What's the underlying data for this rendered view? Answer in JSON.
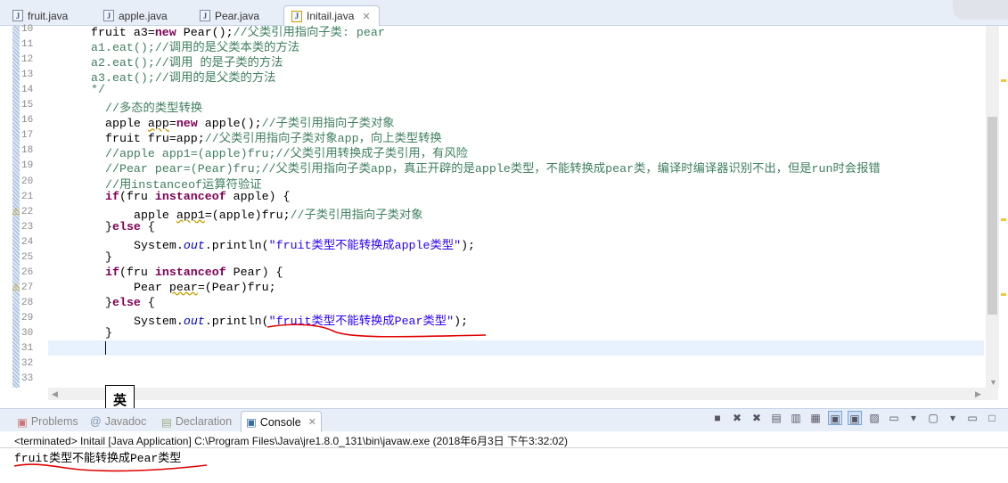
{
  "editor_tabs": [
    {
      "label": "fruit.java",
      "icon": "java-file-icon"
    },
    {
      "label": "apple.java",
      "icon": "java-file-icon"
    },
    {
      "label": "Pear.java",
      "icon": "java-file-icon"
    },
    {
      "label": "Initail.java",
      "icon": "java-file-warning-icon",
      "active": true,
      "close": "✕"
    }
  ],
  "code_lines": [
    {
      "n": "10",
      "indent": 6,
      "segs": [
        [
          "",
          "fruit a3="
        ],
        [
          "kw",
          "new"
        ],
        [
          "",
          " Pear();"
        ],
        [
          "cm",
          "//父类引用指向子类: pear"
        ]
      ]
    },
    {
      "n": "11",
      "indent": 6,
      "segs": [
        [
          "cm",
          "a1.eat();//调用的是父类本类的方法"
        ]
      ]
    },
    {
      "n": "12",
      "indent": 6,
      "segs": [
        [
          "cm",
          "a2.eat();//调用 的是子类的方法"
        ]
      ]
    },
    {
      "n": "13",
      "indent": 6,
      "segs": [
        [
          "cm",
          "a3.eat();//调用的是父类的方法"
        ]
      ]
    },
    {
      "n": "14",
      "indent": 6,
      "segs": [
        [
          "cm",
          "*/"
        ]
      ]
    },
    {
      "n": "15",
      "indent": 8,
      "segs": [
        [
          "cm",
          "//多态的类型转换"
        ]
      ]
    },
    {
      "n": "16",
      "indent": 8,
      "segs": [
        [
          "",
          "apple "
        ],
        [
          "warn",
          "app"
        ],
        [
          "",
          "="
        ],
        [
          "kw",
          "new"
        ],
        [
          "",
          " apple();"
        ],
        [
          "cm",
          "//子类引用指向子类对象"
        ]
      ]
    },
    {
      "n": "17",
      "indent": 8,
      "segs": [
        [
          "",
          "fruit fru=app;"
        ],
        [
          "cm",
          "//父类引用指向子类对象app，向上类型转换"
        ]
      ]
    },
    {
      "n": "18",
      "indent": 8,
      "segs": [
        [
          "cm",
          "//apple app1=(apple)fru;//父类引用转换成子类引用，有风险"
        ]
      ]
    },
    {
      "n": "19",
      "indent": 8,
      "segs": [
        [
          "cm",
          "//Pear pear=(Pear)fru;//父类引用指向子类app，真正开辟的是apple类型，不能转换成pear类，编译时编译器识别不出，但是run时会报错"
        ]
      ]
    },
    {
      "n": "20",
      "indent": 8,
      "segs": [
        [
          "cm",
          "//用instanceof运算符验证"
        ]
      ]
    },
    {
      "n": "21",
      "indent": 8,
      "segs": [
        [
          "kw",
          "if"
        ],
        [
          "",
          "(fru "
        ],
        [
          "kw",
          "instanceof"
        ],
        [
          "",
          " apple) {"
        ]
      ]
    },
    {
      "n": "22",
      "indent": 12,
      "segs": [
        [
          "",
          "apple "
        ],
        [
          "warn",
          "app1"
        ],
        [
          "",
          "=(apple)fru;"
        ],
        [
          "cm",
          "//子类引用指向子类对象"
        ]
      ]
    },
    {
      "n": "23",
      "indent": 8,
      "segs": [
        [
          "",
          "}"
        ],
        [
          "kw",
          "else"
        ],
        [
          "",
          " {"
        ]
      ]
    },
    {
      "n": "24",
      "indent": 12,
      "segs": [
        [
          "",
          "System."
        ],
        [
          "fld",
          "out"
        ],
        [
          "",
          ".println("
        ],
        [
          "str",
          "\"fruit类型不能转换成apple类型\""
        ],
        [
          "",
          ");"
        ]
      ]
    },
    {
      "n": "25",
      "indent": 8,
      "segs": [
        [
          "",
          "}"
        ]
      ]
    },
    {
      "n": "26",
      "indent": 8,
      "segs": [
        [
          "kw",
          "if"
        ],
        [
          "",
          "(fru "
        ],
        [
          "kw",
          "instanceof"
        ],
        [
          "",
          " Pear) {"
        ]
      ]
    },
    {
      "n": "27",
      "indent": 12,
      "segs": [
        [
          "",
          "Pear "
        ],
        [
          "warn",
          "pear"
        ],
        [
          "",
          "=(Pear)fru;"
        ]
      ]
    },
    {
      "n": "28",
      "indent": 8,
      "segs": [
        [
          "",
          "}"
        ],
        [
          "kw",
          "else"
        ],
        [
          "",
          " {"
        ]
      ]
    },
    {
      "n": "29",
      "indent": 12,
      "segs": [
        [
          "",
          "System."
        ],
        [
          "fld",
          "out"
        ],
        [
          "",
          ".println("
        ],
        [
          "str",
          "\"fruit类型不能转换成Pear类型\""
        ],
        [
          "",
          ");"
        ]
      ]
    },
    {
      "n": "30",
      "indent": 8,
      "segs": [
        [
          "",
          "}"
        ]
      ]
    },
    {
      "n": "31",
      "indent": 0,
      "segs": []
    },
    {
      "n": "32",
      "indent": 0,
      "segs": []
    },
    {
      "n": "33",
      "indent": 0,
      "segs": []
    }
  ],
  "ime_indicator": "英",
  "panel_tabs": [
    {
      "label": "Problems",
      "icon": "problems-icon"
    },
    {
      "label": "Javadoc",
      "icon": "javadoc-icon"
    },
    {
      "label": "Declaration",
      "icon": "declaration-icon"
    },
    {
      "label": "Console",
      "icon": "console-icon",
      "active": true,
      "close": "✕"
    }
  ],
  "console": {
    "header": "<terminated> Initail [Java Application] C:\\Program Files\\Java\\jre1.8.0_131\\bin\\javaw.exe (2018年6月3日 下午3:32:02)",
    "output": "fruit类型不能转换成Pear类型"
  },
  "colors": {
    "keyword": "#7f0055",
    "comment": "#3f7f5f",
    "string": "#2a00ff",
    "annotation": "#e00000"
  }
}
